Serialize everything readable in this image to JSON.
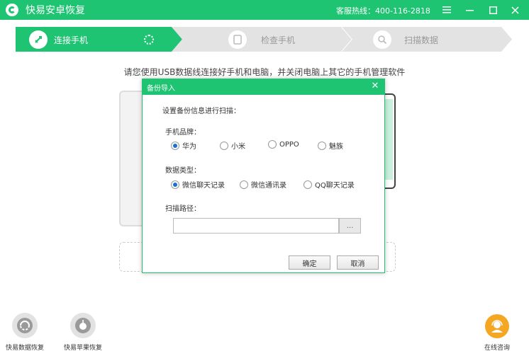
{
  "titlebar": {
    "title": "快易安卓恢复",
    "hotline": "客服热线：400-116-2818",
    "menu_icon": "hamburger-icon",
    "minimize_icon": "minimize-icon",
    "maximize_icon": "maximize-icon",
    "close_icon": "close-icon"
  },
  "steps": [
    {
      "label": "连接手机",
      "icon": "usb-icon",
      "state": "active"
    },
    {
      "label": "检查手机",
      "icon": "phone-icon",
      "state": "pending"
    },
    {
      "label": "扫描数据",
      "icon": "search-icon",
      "state": "pending"
    }
  ],
  "hint": "请您使用USB数据线连接好手机和电脑，并关闭电脑上其它的手机管理软件",
  "dialog": {
    "title": "备份导入",
    "heading": "设置备份信息进行扫描：",
    "brand_label": "手机品牌：",
    "brands": [
      "华为",
      "小米",
      "OPPO",
      "魅族"
    ],
    "brand_selected": "华为",
    "type_label": "数据类型：",
    "types": [
      "微信聊天记录",
      "微信通讯录",
      "QQ聊天记录"
    ],
    "type_selected": "微信聊天记录",
    "path_label": "扫描路径：",
    "path_value": "",
    "browse_label": "...",
    "ok_label": "确定",
    "cancel_label": "取消"
  },
  "bottom_tools": [
    {
      "label": "快易数据恢复",
      "icon": "data-recovery-icon"
    },
    {
      "label": "快易苹果恢复",
      "icon": "apple-recovery-icon"
    }
  ],
  "support": {
    "label": "在线咨询",
    "icon": "customer-service-icon"
  },
  "colors": {
    "accent": "#1ec472",
    "step_pending": "#e3e3e3",
    "support": "#f5a623",
    "radio_dot": "#1b6fd1"
  }
}
